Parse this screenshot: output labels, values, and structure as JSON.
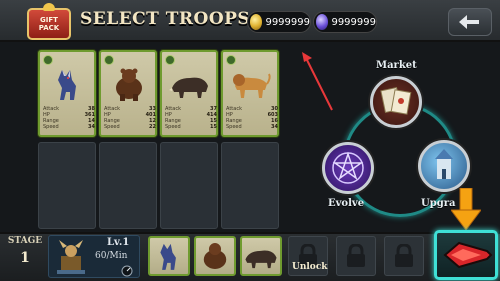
{
  "header": {
    "gift_label_line1": "GIFT",
    "gift_label_line2": "PACK",
    "title": "SELECT TROOPS",
    "coins": "9999999",
    "gems": "9999999"
  },
  "troops": [
    {
      "name": "Wolf",
      "icon": "wolf-icon",
      "stats": [
        [
          "Attack",
          "38"
        ],
        [
          "HP",
          "361"
        ],
        [
          "Range",
          "14"
        ],
        [
          "Speed",
          "34"
        ]
      ]
    },
    {
      "name": "Bear",
      "icon": "bear-icon",
      "stats": [
        [
          "Attack",
          "33"
        ],
        [
          "HP",
          "401"
        ],
        [
          "Range",
          "12"
        ],
        [
          "Speed",
          "22"
        ]
      ]
    },
    {
      "name": "Boar",
      "icon": "boar-icon",
      "stats": [
        [
          "Attack",
          "37"
        ],
        [
          "HP",
          "414"
        ],
        [
          "Range",
          "15"
        ],
        [
          "Speed",
          "15"
        ]
      ]
    },
    {
      "name": "Lion",
      "icon": "lion-icon",
      "stats": [
        [
          "Attack",
          "30"
        ],
        [
          "HP",
          "603"
        ],
        [
          "Range",
          "16"
        ],
        [
          "Speed",
          "34"
        ]
      ]
    }
  ],
  "menu": {
    "market_label": "Market",
    "evolve_label": "Evolve",
    "upgrade_label": "Upgra"
  },
  "bottom": {
    "stage_label": "STAGE",
    "stage_number": "1",
    "hero_level": "Lv.1",
    "hero_rate": "60/Min",
    "unlock_label": "Unlock"
  },
  "colors": {
    "accent_teal": "#3fe0d6",
    "card_border_green": "#6f9b2f",
    "pointer_red": "#e8383a",
    "arrow_orange": "#f5a212"
  }
}
